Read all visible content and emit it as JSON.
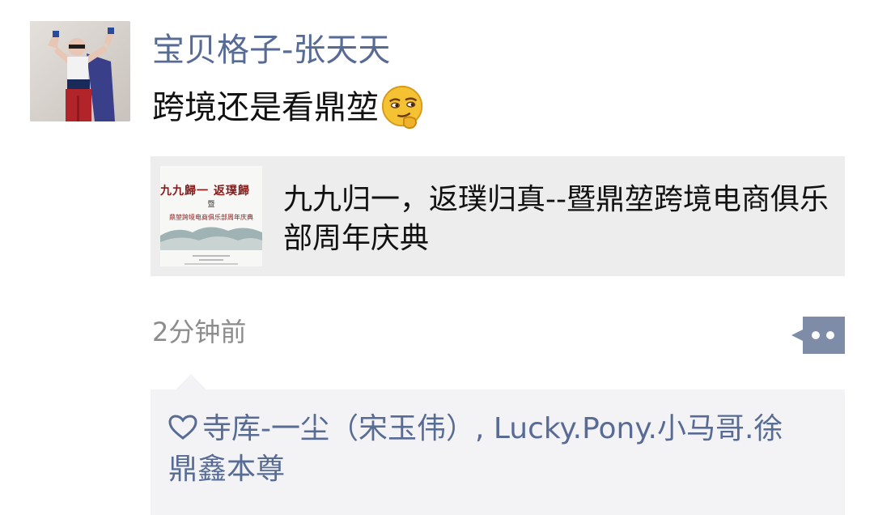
{
  "post": {
    "username": "宝贝格子-张天天",
    "text": "跨境还是看鼎堃",
    "emoji_icon": "smirk-emoji"
  },
  "link": {
    "title": "九九归一，返璞归真--暨鼎堃跨境电商俱乐部周年庆典",
    "thumb_line1": "九九歸一 返璞歸",
    "thumb_line2": "暨",
    "thumb_line3": "鼎堃跨境电商俱乐部周年庆典"
  },
  "meta": {
    "timestamp": "2分钟前",
    "comment_icon": "more-dots-icon"
  },
  "likes": {
    "icon": "heart-outline-icon",
    "names": "寺库-一尘（宋玉伟）, Lucky.Pony.小马哥.徐鼎鑫本尊"
  },
  "colors": {
    "name_blue": "#576b95",
    "card_bg": "#ededed",
    "likes_bg": "#f3f3f5"
  }
}
